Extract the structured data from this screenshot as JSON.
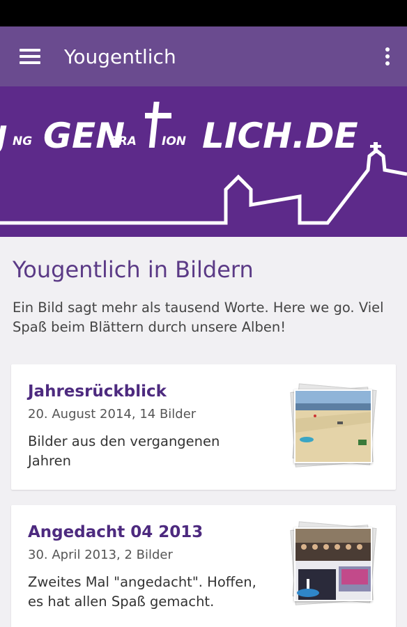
{
  "app": {
    "title": "Yougentlich"
  },
  "banner": {
    "logo_text": "JUNG GENERATION LICH.DE"
  },
  "section": {
    "title": "Yougentlich in Bildern",
    "description": "Ein Bild sagt mehr als tausend Worte. Here we go. Viel Spaß beim Blättern durch unsere Alben!"
  },
  "albums": [
    {
      "title": "Jahresrückblick",
      "meta": "20. August 2014, 14 Bilder",
      "description": "Bilder aus den vergangenen Jahren",
      "thumb_icon": "beach-photo-thumbnail"
    },
    {
      "title": "Angedacht 04 2013",
      "meta": "30. April 2013, 2 Bilder",
      "description": "Zweites Mal \"angedacht\". Hoffen, es hat allen Spaß gemacht.",
      "thumb_icon": "group-photo-thumbnail"
    }
  ],
  "colors": {
    "appbar": "#6a4b8f",
    "banner": "#5d2a8a",
    "accent_text": "#5b3a86",
    "background": "#f1f0f3"
  }
}
